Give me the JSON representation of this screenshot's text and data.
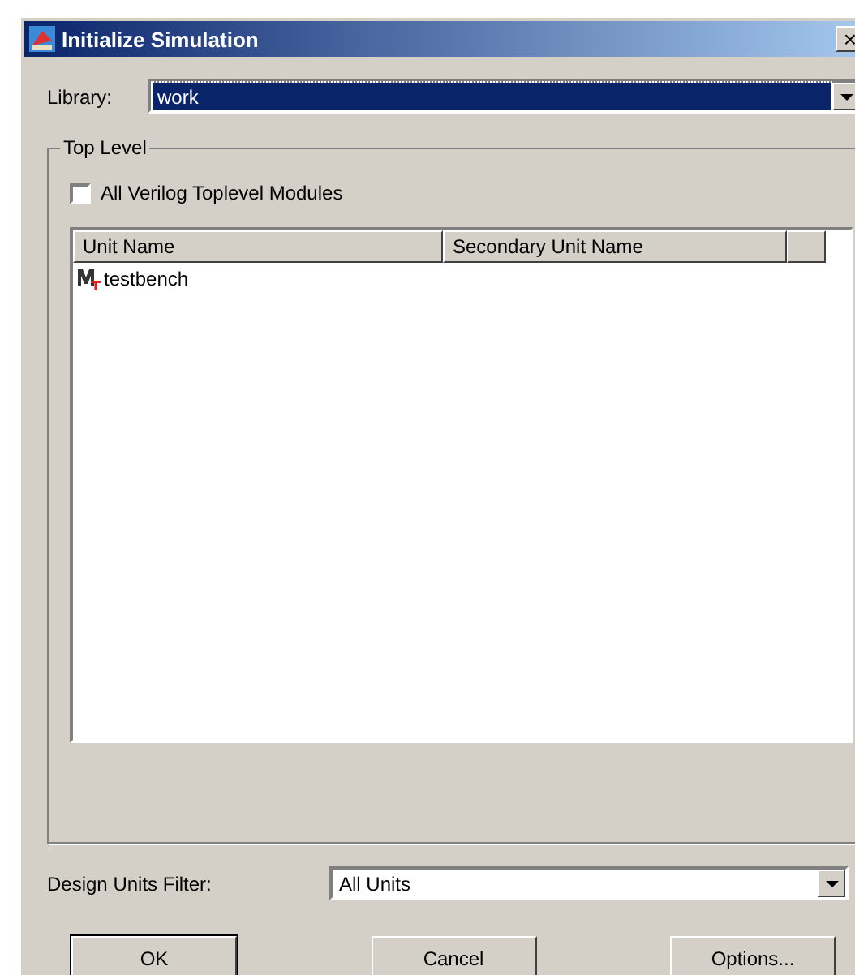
{
  "window": {
    "title": "Initialize Simulation",
    "close": "×"
  },
  "library": {
    "label": "Library:",
    "value": "work",
    "focused": true
  },
  "top_level": {
    "title": "Top Level",
    "all_verilog": {
      "label": "All Verilog Toplevel Modules",
      "checked": false
    },
    "table": {
      "columns": [
        "Unit Name",
        "Secondary Unit Name"
      ],
      "rows": [
        {
          "unit_name": "testbench",
          "kind": "module"
        }
      ]
    }
  },
  "filter": {
    "label": "Design Units Filter:",
    "value": "All Units"
  },
  "buttons": [
    {
      "label": "OK",
      "default": true
    },
    {
      "label": "Cancel",
      "default": false
    },
    {
      "label": "Options...",
      "default": false
    }
  ]
}
